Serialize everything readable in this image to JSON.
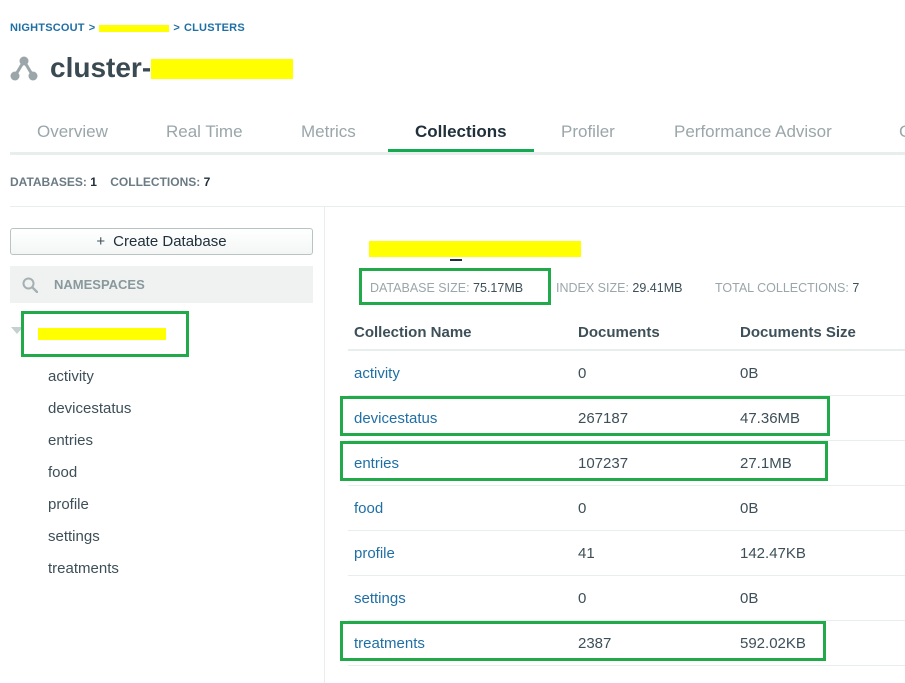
{
  "breadcrumb": {
    "root": "NIGHTSCOUT",
    "sep1": ">",
    "sep2": ">",
    "current": "CLUSTERS"
  },
  "cluster": {
    "title_prefix": "cluster-",
    "title_visible_suffix": ""
  },
  "tabs": [
    {
      "label": "Overview",
      "active": false
    },
    {
      "label": "Real Time",
      "active": false
    },
    {
      "label": "Metrics",
      "active": false
    },
    {
      "label": "Collections",
      "active": true
    },
    {
      "label": "Profiler",
      "active": false
    },
    {
      "label": "Performance Advisor",
      "active": false
    },
    {
      "label": "C",
      "active": false
    }
  ],
  "stats": {
    "databases_label": "DATABASES:",
    "databases_value": "1",
    "collections_label": "COLLECTIONS:",
    "collections_value": "7"
  },
  "sidebar": {
    "create_label": "Create Database",
    "search_placeholder": "NAMESPACES",
    "collections": [
      "activity",
      "devicestatus",
      "entries",
      "food",
      "profile",
      "settings",
      "treatments"
    ]
  },
  "db_stats": {
    "db_size_label": "DATABASE SIZE:",
    "db_size_value": "75.17MB",
    "index_size_label": "INDEX SIZE:",
    "index_size_value": "29.41MB",
    "total_label": "TOTAL COLLECTIONS:",
    "total_value": "7"
  },
  "table": {
    "headers": [
      "Collection Name",
      "Documents",
      "Documents Size"
    ],
    "rows": [
      {
        "name": "activity",
        "documents": "0",
        "size": "0B"
      },
      {
        "name": "devicestatus",
        "documents": "267187",
        "size": "47.36MB"
      },
      {
        "name": "entries",
        "documents": "107237",
        "size": "27.1MB"
      },
      {
        "name": "food",
        "documents": "0",
        "size": "0B"
      },
      {
        "name": "profile",
        "documents": "41",
        "size": "142.47KB"
      },
      {
        "name": "settings",
        "documents": "0",
        "size": "0B"
      },
      {
        "name": "treatments",
        "documents": "2387",
        "size": "592.02KB"
      }
    ]
  },
  "colors": {
    "accent_green": "#13aa52",
    "link_blue": "#1f6fa5",
    "highlight_box": "#22a94a",
    "redaction": "#ffff00"
  }
}
